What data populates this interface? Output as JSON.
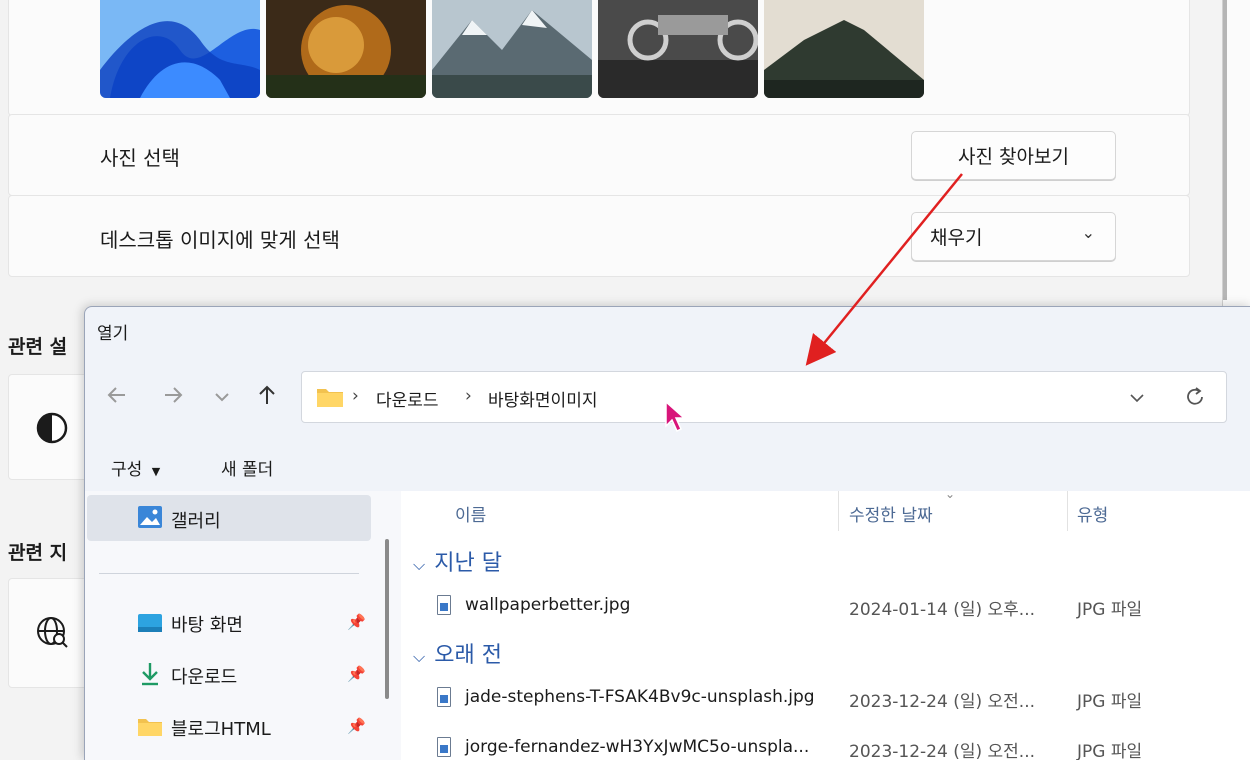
{
  "settings": {
    "rows": {
      "choose_photo_label": "사진 선택",
      "browse_button": "사진 찾아보기",
      "fit_label": "데스크톱 이미지에 맞게 선택",
      "fit_value": "채우기"
    },
    "related_settings_title": "관련 설",
    "related_support_title": "관련 지"
  },
  "dialog": {
    "title": "열기",
    "breadcrumb": [
      "다운로드",
      "바탕화면이미지"
    ],
    "toolbar": {
      "organize": "구성",
      "new_folder": "새 폴더"
    },
    "nav": {
      "gallery": "갤러리",
      "desktop": "바탕 화면",
      "downloads": "다운로드",
      "blog_html": "블로그HTML"
    },
    "columns": {
      "name": "이름",
      "modified": "수정한 날짜",
      "type": "유형"
    },
    "groups": [
      {
        "name": "지난 달",
        "files": [
          {
            "name": "wallpaperbetter.jpg",
            "date": "2024-01-14 (일) 오후...",
            "type": "JPG 파일"
          }
        ]
      },
      {
        "name": "오래 전",
        "files": [
          {
            "name": "jade-stephens-T-FSAK4Bv9c-unsplash.jpg",
            "date": "2023-12-24 (일) 오전...",
            "type": "JPG 파일"
          },
          {
            "name": "jorge-fernandez-wH3YxJwMC5o-unspla...",
            "date": "2023-12-24 (일) 오전...",
            "type": "JPG 파일"
          }
        ]
      }
    ]
  },
  "colors": {
    "accent": "#2b5aa8",
    "arrow": "#e02020",
    "cursor": "#d8157a"
  }
}
